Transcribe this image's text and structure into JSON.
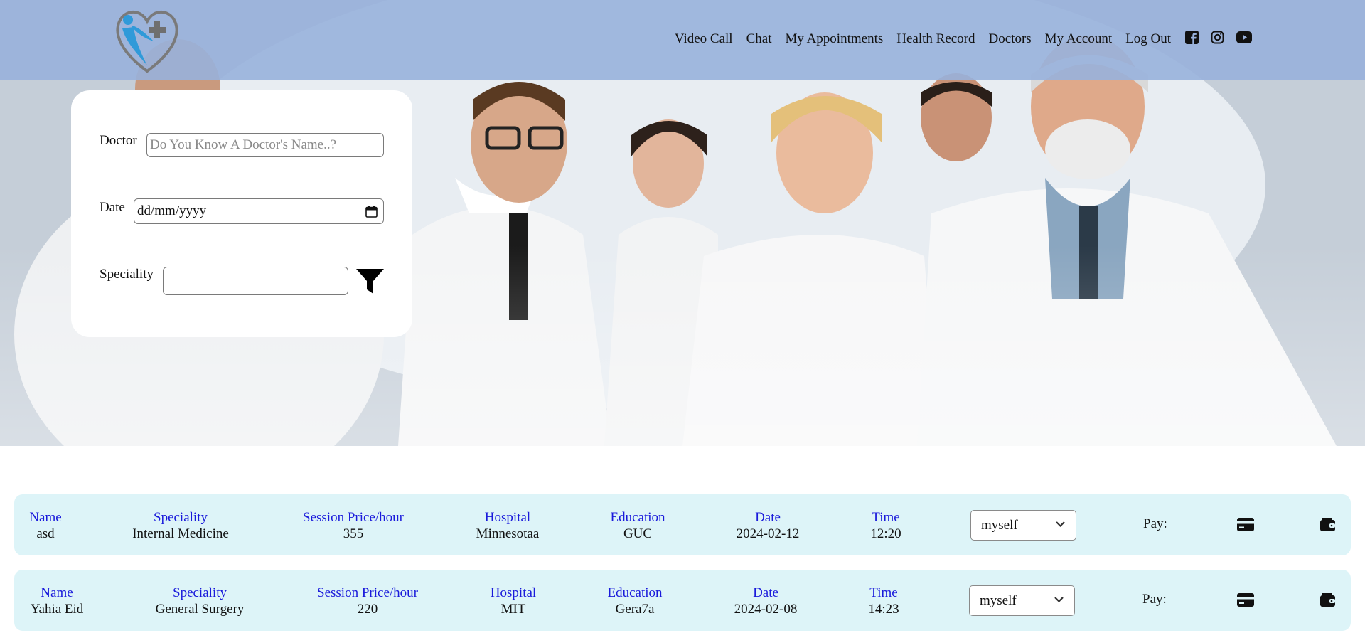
{
  "header": {
    "nav": [
      "Video Call",
      "Chat",
      "My Appointments",
      "Health Record",
      "Doctors",
      "My Account",
      "Log Out"
    ],
    "social_icons": [
      "facebook-icon",
      "instagram-icon",
      "youtube-icon"
    ]
  },
  "filter": {
    "doctor_label": "Doctor",
    "doctor_placeholder": "Do You Know A Doctor's Name..?",
    "date_label": "Date",
    "date_value": "dd/mm/yyyy",
    "speciality_label": "Speciality",
    "speciality_value": ""
  },
  "columns": {
    "name": "Name",
    "speciality": "Speciality",
    "price": "Session Price/hour",
    "hospital": "Hospital",
    "education": "Education",
    "date": "Date",
    "time": "Time"
  },
  "appointments": [
    {
      "name": "asd",
      "speciality": "Internal Medicine",
      "price": "355",
      "hospital": "Minnesotaa",
      "education": "GUC",
      "date": "2024-02-12",
      "time": "12:20",
      "for": "myself",
      "pay_label": "Pay:"
    },
    {
      "name": "Yahia Eid",
      "speciality": "General Surgery",
      "price": "220",
      "hospital": "MIT",
      "education": "Gera7a",
      "date": "2024-02-08",
      "time": "14:23",
      "for": "myself",
      "pay_label": "Pay:"
    }
  ],
  "colors": {
    "header_bg": "#98b1dc",
    "row_bg": "#ddf4f8",
    "heading_text": "#1a1adb",
    "logo_blue": "#2f9ad9",
    "logo_gray": "#777777"
  }
}
